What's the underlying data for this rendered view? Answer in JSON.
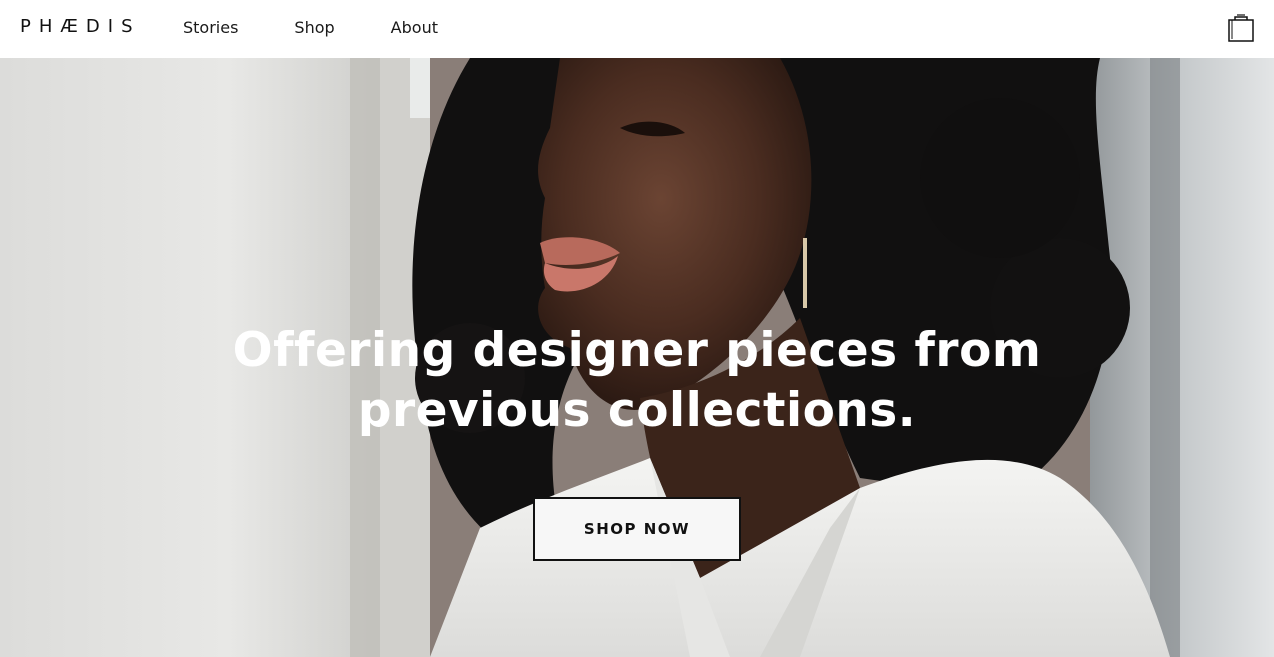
{
  "header": {
    "logo": "PHÆDIS",
    "nav": [
      {
        "label": "Stories"
      },
      {
        "label": "Shop"
      },
      {
        "label": "About"
      }
    ],
    "cart_icon": "shopping-bag-icon"
  },
  "hero": {
    "headline_line1": "Offering designer pieces from",
    "headline_line2": "previous collections.",
    "cta_label": "SHOP NOW",
    "image": "portrait-photo"
  },
  "colors": {
    "text_dark": "#111111",
    "header_bg": "#ffffff",
    "headline": "#ffffff",
    "button_bg": "#f7f7f7"
  }
}
